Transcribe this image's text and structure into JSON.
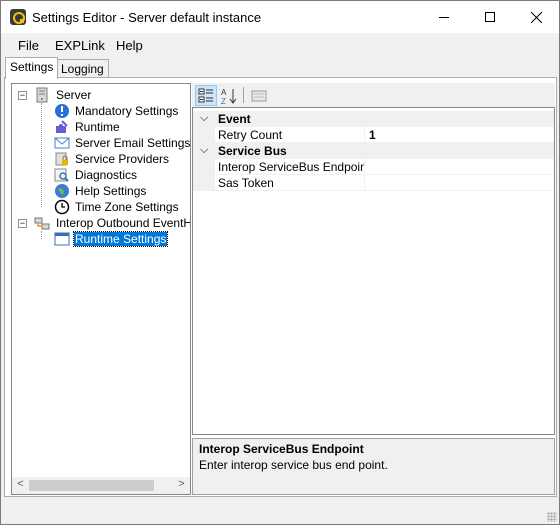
{
  "window": {
    "title": "Settings Editor - Server default instance"
  },
  "menu": {
    "file": "File",
    "explink": "EXPLink",
    "help": "Help"
  },
  "tabs": {
    "settings": "Settings",
    "logging": "Logging"
  },
  "tree": {
    "server": "Server",
    "children": [
      "Mandatory Settings",
      "Runtime",
      "Server Email Settings",
      "Service Providers",
      "Diagnostics",
      "Help Settings",
      "Time Zone Settings"
    ],
    "interop": "Interop Outbound EventHan",
    "interop_child": "Runtime Settings"
  },
  "grid": {
    "cat_event": "Event",
    "retry_label": "Retry Count",
    "retry_value": "1",
    "cat_bus": "Service Bus",
    "endpoint_label": "Interop ServiceBus Endpoint",
    "endpoint_value": "",
    "sas_label": "Sas Token",
    "sas_value": ""
  },
  "description": {
    "title": "Interop ServiceBus Endpoint",
    "text": "Enter interop service bus end point."
  },
  "icons": {
    "app": "app-icon",
    "server": "server-icon",
    "mandatory": "info-icon",
    "runtime": "puzzle-icon",
    "email": "envelope-icon",
    "providers": "lock-icon",
    "diagnostics": "magnifier-icon",
    "help": "globe-icon",
    "timezone": "clock-icon",
    "interop": "network-icon",
    "runtime_settings": "window-icon"
  },
  "colors": {
    "selection": "#0078d7",
    "accent": "#f5c400"
  }
}
